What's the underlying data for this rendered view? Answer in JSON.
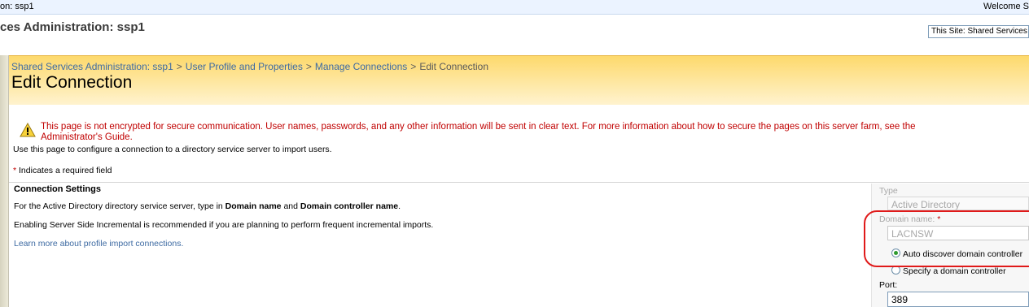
{
  "header": {
    "breadcrumb": "on: ssp1",
    "welcome": "Welcome S",
    "site_title": "ces Administration: ssp1",
    "search_scope": "This Site: Shared Services"
  },
  "nav": {
    "breadcrumb": [
      "Shared Services Administration: ssp1",
      "User Profile and Properties",
      "Manage Connections"
    ],
    "separator": ">",
    "current": "Edit Connection"
  },
  "page": {
    "title": "Edit Connection",
    "warning_line1": "This page is not encrypted for secure communication. User names, passwords, and any other information will be sent in clear text. For more information about how to secure the pages on this server farm, see the",
    "warning_line2": "Administrator's Guide.",
    "description": "Use this page to configure a connection to a directory service server to import users.",
    "required_star": "*",
    "required_text": "Indicates a required field"
  },
  "section": {
    "title": "Connection Settings",
    "p1_pre": "For the Active Directory directory service server, type in ",
    "p1_b1": "Domain name",
    "p1_mid": " and ",
    "p1_b2": "Domain controller name",
    "p1_post": ".",
    "p2": "Enabling Server Side Incremental is recommended if you are planning to perform frequent incremental imports.",
    "link": "Learn more about profile import connections."
  },
  "form": {
    "type_label": "Type",
    "type_value": "Active Directory",
    "domain_label": "Domain name:",
    "domain_star": "*",
    "domain_value": "LACNSW",
    "radio_auto": "Auto discover domain controller",
    "radio_specify": "Specify a domain controller",
    "port_label": "Port:",
    "port_value": "389"
  },
  "colors": {
    "warning_red": "#c00000",
    "link_blue": "#3d6aa2",
    "title_band": "#fdd96c",
    "highlight_red": "#e01a1a"
  }
}
